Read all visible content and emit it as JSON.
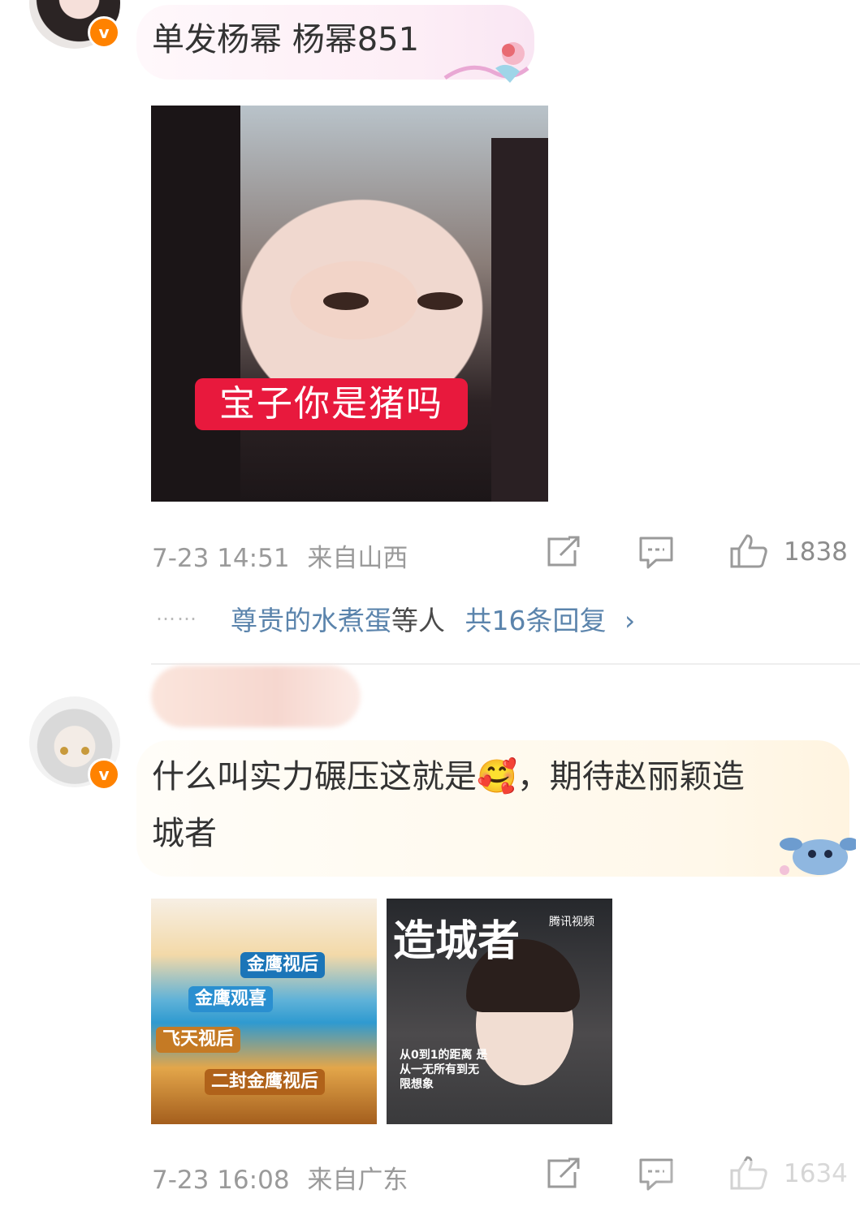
{
  "comments": [
    {
      "text": "单发杨幂 杨幂851",
      "image_caption": "宝子你是猪吗",
      "time": "7-23 14:51",
      "location": "来自山西",
      "likes": "1838",
      "replies": {
        "dots": "……",
        "names": "尊贵的水煮蛋",
        "others": "等人",
        "count": "共16条回复",
        "chevron": "›"
      }
    },
    {
      "text_part1": "什么叫实力碾压这就是",
      "emoji": "🥰",
      "text_part2": "，期待赵丽颖造",
      "text_line2": "城者",
      "time": "7-23 16:08",
      "location": "来自广东",
      "likes": "1634",
      "poster_title": "造城者",
      "poster_brand": "腾讯视频",
      "poster_tagline": "从0到1的距离 是从一无所有到无限想象",
      "award_tags": [
        "金鹰视后",
        "金鹰观喜",
        "飞天视后",
        "二封金鹰视后"
      ]
    }
  ],
  "icons": {
    "verified": "verified-v-icon",
    "repost": "repost-icon",
    "comment": "comment-icon",
    "like": "thumbs-up-icon"
  },
  "colors": {
    "verified_badge": "#ff8200",
    "link": "#5b84ac",
    "meta": "#9a9a9a"
  }
}
